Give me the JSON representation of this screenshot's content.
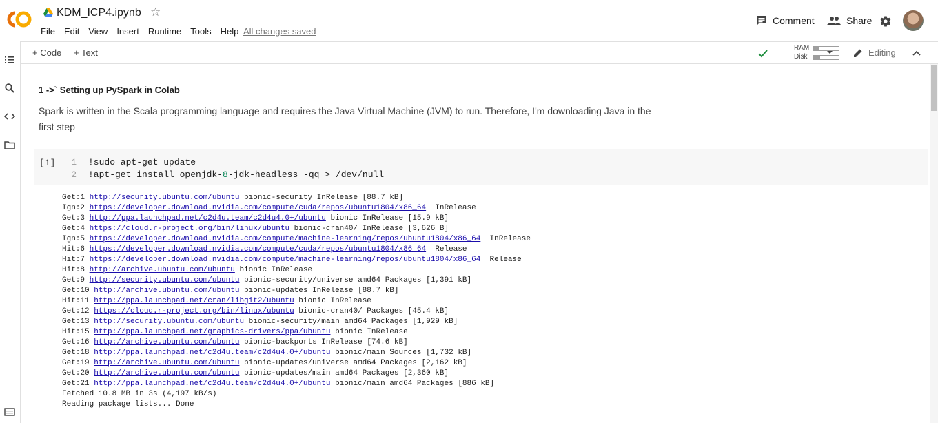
{
  "header": {
    "title": "KDM_ICP4.ipynb",
    "menu": [
      "File",
      "Edit",
      "View",
      "Insert",
      "Runtime",
      "Tools",
      "Help"
    ],
    "save_status": "All changes saved",
    "comment_label": "Comment",
    "share_label": "Share"
  },
  "toolbar": {
    "add_code": "+ Code",
    "add_text": "+ Text",
    "ram_label": "RAM",
    "disk_label": "Disk",
    "ram_fraction": 0.2,
    "disk_fraction": 0.25,
    "editing_label": "Editing"
  },
  "text_cell": {
    "heading": "1 ->` Setting up PySpark in Colab",
    "paragraph_line1": "Spark is written in the Scala programming language and requires the Java Virtual Machine (JVM) to run. Therefore, I'm downloading Java in the",
    "paragraph_line2": "first step"
  },
  "code_cell": {
    "exec_count": "[1]",
    "line_numbers": [
      "1",
      "2"
    ],
    "line1": "!sudo apt-get update",
    "line2_a": "!apt-get install openjdk-",
    "line2_num": "8",
    "line2_b": "-jdk-headless -qq > ",
    "line2_path": "/dev/null"
  },
  "output": [
    {
      "prefix": "Get:1 ",
      "url": "http://security.ubuntu.com/ubuntu",
      "suffix": " bionic-security InRelease [88.7 kB]"
    },
    {
      "prefix": "Ign:2 ",
      "url": "https://developer.download.nvidia.com/compute/cuda/repos/ubuntu1804/x86_64",
      "suffix": "  InRelease"
    },
    {
      "prefix": "Get:3 ",
      "url": "http://ppa.launchpad.net/c2d4u.team/c2d4u4.0+/ubuntu",
      "suffix": " bionic InRelease [15.9 kB]"
    },
    {
      "prefix": "Get:4 ",
      "url": "https://cloud.r-project.org/bin/linux/ubuntu",
      "suffix": " bionic-cran40/ InRelease [3,626 B]"
    },
    {
      "prefix": "Ign:5 ",
      "url": "https://developer.download.nvidia.com/compute/machine-learning/repos/ubuntu1804/x86_64",
      "suffix": "  InRelease"
    },
    {
      "prefix": "Hit:6 ",
      "url": "https://developer.download.nvidia.com/compute/cuda/repos/ubuntu1804/x86_64",
      "suffix": "  Release"
    },
    {
      "prefix": "Hit:7 ",
      "url": "https://developer.download.nvidia.com/compute/machine-learning/repos/ubuntu1804/x86_64",
      "suffix": "  Release"
    },
    {
      "prefix": "Hit:8 ",
      "url": "http://archive.ubuntu.com/ubuntu",
      "suffix": " bionic InRelease"
    },
    {
      "prefix": "Get:9 ",
      "url": "http://security.ubuntu.com/ubuntu",
      "suffix": " bionic-security/universe amd64 Packages [1,391 kB]"
    },
    {
      "prefix": "Get:10 ",
      "url": "http://archive.ubuntu.com/ubuntu",
      "suffix": " bionic-updates InRelease [88.7 kB]"
    },
    {
      "prefix": "Hit:11 ",
      "url": "http://ppa.launchpad.net/cran/libgit2/ubuntu",
      "suffix": " bionic InRelease"
    },
    {
      "prefix": "Get:12 ",
      "url": "https://cloud.r-project.org/bin/linux/ubuntu",
      "suffix": " bionic-cran40/ Packages [45.4 kB]"
    },
    {
      "prefix": "Get:13 ",
      "url": "http://security.ubuntu.com/ubuntu",
      "suffix": " bionic-security/main amd64 Packages [1,929 kB]"
    },
    {
      "prefix": "Hit:15 ",
      "url": "http://ppa.launchpad.net/graphics-drivers/ppa/ubuntu",
      "suffix": " bionic InRelease"
    },
    {
      "prefix": "Get:16 ",
      "url": "http://archive.ubuntu.com/ubuntu",
      "suffix": " bionic-backports InRelease [74.6 kB]"
    },
    {
      "prefix": "Get:18 ",
      "url": "http://ppa.launchpad.net/c2d4u.team/c2d4u4.0+/ubuntu",
      "suffix": " bionic/main Sources [1,732 kB]"
    },
    {
      "prefix": "Get:19 ",
      "url": "http://archive.ubuntu.com/ubuntu",
      "suffix": " bionic-updates/universe amd64 Packages [2,162 kB]"
    },
    {
      "prefix": "Get:20 ",
      "url": "http://archive.ubuntu.com/ubuntu",
      "suffix": " bionic-updates/main amd64 Packages [2,360 kB]"
    },
    {
      "prefix": "Get:21 ",
      "url": "http://ppa.launchpad.net/c2d4u.team/c2d4u4.0+/ubuntu",
      "suffix": " bionic/main amd64 Packages [886 kB]"
    },
    {
      "prefix": "Fetched 10.8 MB in 3s (4,197 kB/s)",
      "url": "",
      "suffix": ""
    },
    {
      "prefix": "Reading package lists... Done",
      "url": "",
      "suffix": ""
    }
  ],
  "colors": {
    "colab_orange": "#F9AB00",
    "colab_dark_orange": "#E8710A",
    "check_green": "#1e8e3e",
    "link_blue": "#1a0dab"
  }
}
